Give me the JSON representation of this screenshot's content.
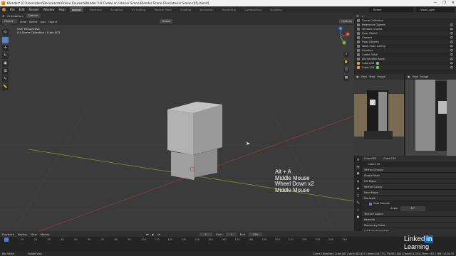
{
  "window": {
    "title": "Blender* [C:\\Users\\dani\\Documents\\Online Courses\\Blender 2.8 Create an Interior Scene\\Blender Scene Files\\Interior Scene (55).blend]",
    "controls": [
      "—",
      "❐",
      "✕"
    ]
  },
  "menubar": {
    "items": [
      "File",
      "Edit",
      "Render",
      "Window",
      "Help"
    ],
    "workspaces": [
      "Layout",
      "Modeling",
      "Sculpting",
      "UV Editing",
      "Texture Paint",
      "Shading",
      "Animation",
      "Rendering",
      "Compositing",
      "Scripting"
    ],
    "active_workspace": "Layout",
    "scene": "Scene",
    "view_layer": "View Layer"
  },
  "viewport_header": {
    "transform_label": "Orientation:",
    "orientation": "Default",
    "mode": "Object Mode",
    "menus": [
      "View",
      "Select",
      "Add",
      "Object"
    ],
    "pivot": "Global",
    "options": "Options"
  },
  "viewport": {
    "perspective": "User Perspective",
    "collection": "(1) Scene Collection | Cube.003",
    "keyhint": [
      "Alt + A",
      "Middle Mouse",
      "Wheel Down x2",
      "Middle Mouse"
    ]
  },
  "gizmo": {
    "x": "X",
    "y": "Y",
    "z": "Z"
  },
  "outliner": {
    "title": "Scene Collection",
    "rows": [
      {
        "name": "Reference Objects",
        "type": "col"
      },
      {
        "name": "Window Frames",
        "type": "col"
      },
      {
        "name": "Floor Object",
        "type": "col"
      },
      {
        "name": "Camera",
        "type": "col"
      },
      {
        "name": "Floor Objects",
        "type": "col"
      },
      {
        "name": "Walls Floor Ceiling",
        "type": "col"
      },
      {
        "name": "Couches",
        "type": "col"
      },
      {
        "name": "Coffee Table",
        "type": "col"
      },
      {
        "name": "Kitchenette Room",
        "type": "col"
      },
      {
        "name": "Cube.003",
        "type": "obj"
      },
      {
        "name": "Cube.119",
        "type": "obj"
      }
    ]
  },
  "image_editor": {
    "left_menus": [
      "View",
      "View",
      "Image"
    ],
    "right_menus": [
      "View",
      "Image"
    ]
  },
  "properties": {
    "object_tab": "Cube.003",
    "data_tab": "Cube.119",
    "mesh": "Cube.119",
    "sections": [
      "Vertex Groups",
      "Shape Keys",
      "UV Maps",
      "Vertex Colors",
      "Face Maps",
      "Normals"
    ],
    "auto_smooth_label": "Auto Smooth",
    "angle_label": "Angle",
    "angle_value": "30°",
    "sections2": [
      "Texture Space",
      "Remesh",
      "Geometry Data",
      "Custom Properties"
    ]
  },
  "timeline": {
    "menus": [
      "Playback",
      "Keying",
      "View",
      "Marker"
    ],
    "current_frame": "1",
    "start_label": "Start",
    "start": "1",
    "end_label": "End",
    "end": "250",
    "ruler": [
      "0",
      "10",
      "20",
      "30",
      "40",
      "50",
      "60",
      "70",
      "80",
      "90",
      "100",
      "110",
      "120",
      "130",
      "140",
      "150",
      "160",
      "170",
      "180",
      "190",
      "200",
      "210",
      "220",
      "230",
      "240",
      "250"
    ]
  },
  "statusbar": {
    "left": "Box Select",
    "middle": "Rotate View",
    "right": "Scene Collection | Cube.003 | Verts:482,897 | Faces:448,773 | Tris:852,080 | Objects:1/154 | Mem: 562.2 MiB | v2.80.75"
  },
  "brand": {
    "text": "Linked",
    "badge": "in",
    "suffix": "Learning"
  }
}
